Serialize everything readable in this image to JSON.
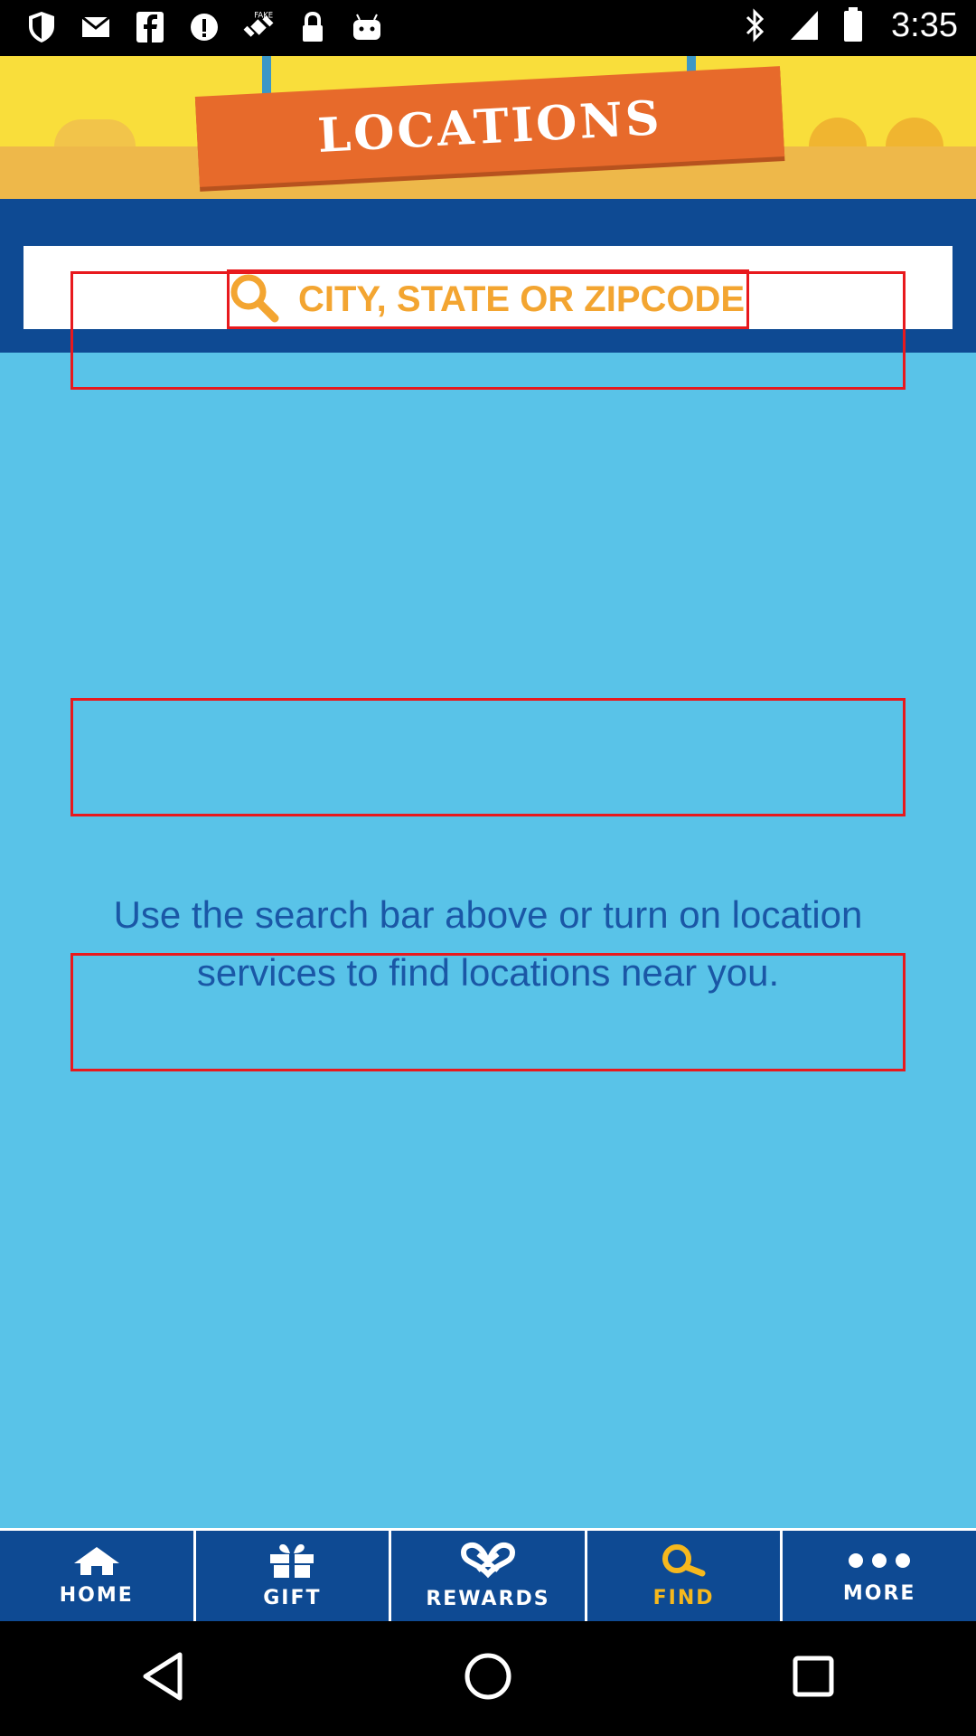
{
  "status_bar": {
    "time": "3:35",
    "left_icons": [
      "shield-icon",
      "mail-icon",
      "facebook-icon",
      "info-icon",
      "fake-gps-icon",
      "lock-icon",
      "android-icon"
    ],
    "right_icons": [
      "bluetooth-icon",
      "signal-icon",
      "battery-icon"
    ]
  },
  "banner": {
    "title": "LOCATIONS"
  },
  "search": {
    "placeholder": "CITY, STATE OR ZIPCODE",
    "value": ""
  },
  "main": {
    "message": "Use the search bar above or turn on location services to find locations near you."
  },
  "tabs": [
    {
      "label": "HOME",
      "icon": "home-icon",
      "active": false
    },
    {
      "label": "GIFT",
      "icon": "gift-icon",
      "active": false
    },
    {
      "label": "REWARDS",
      "icon": "pretzel-icon",
      "active": false
    },
    {
      "label": "FIND",
      "icon": "search-icon",
      "active": true
    },
    {
      "label": "MORE",
      "icon": "more-icon",
      "active": false
    }
  ],
  "nav_bar": [
    "back-icon",
    "home-circle-icon",
    "recents-icon"
  ],
  "colors": {
    "banner_bg": "#f9de3b",
    "banner_label": "#e76a2b",
    "search_zone": "#0e4a93",
    "content_bg": "#59c3e8",
    "message_text": "#1a57a6",
    "placeholder": "#f3a531",
    "tab_active": "#f6b81d",
    "overlay_box": "#e8191d"
  }
}
